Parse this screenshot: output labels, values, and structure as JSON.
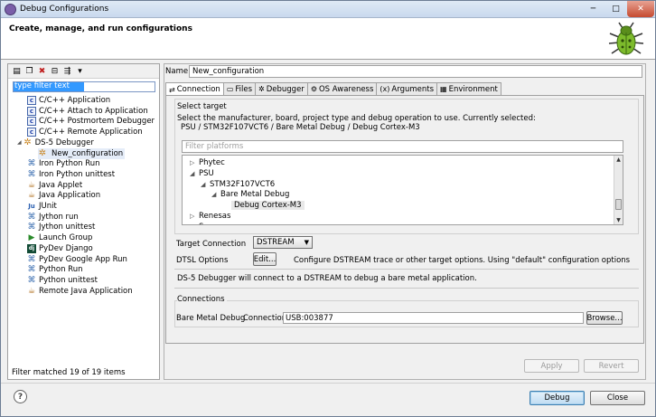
{
  "window": {
    "title": "Debug Configurations",
    "minimize_glyph": "─",
    "maximize_glyph": "□",
    "close_glyph": "✕"
  },
  "header": {
    "heading": "Create, manage, and run configurations",
    "icon": "bug-icon"
  },
  "left": {
    "toolbar": [
      {
        "name": "new-config-icon",
        "glyph": "▤"
      },
      {
        "name": "duplicate-icon",
        "glyph": "❐"
      },
      {
        "name": "delete-icon",
        "glyph": "✖"
      },
      {
        "name": "collapse-all-icon",
        "glyph": "⊟"
      },
      {
        "name": "filter-icon",
        "glyph": "⇶"
      },
      {
        "name": "dropdown-icon",
        "glyph": "▾"
      }
    ],
    "filter_text": "type filter text",
    "tree": [
      {
        "label": "C/C++ Application",
        "icon": "c-icon",
        "depth": 1
      },
      {
        "label": "C/C++ Attach to Application",
        "icon": "c-icon",
        "depth": 1
      },
      {
        "label": "C/C++ Postmortem Debugger",
        "icon": "c-icon",
        "depth": 1
      },
      {
        "label": "C/C++ Remote Application",
        "icon": "c-icon",
        "depth": 1
      },
      {
        "label": "DS-5 Debugger",
        "icon": "ds5-icon",
        "depth": 0,
        "expanded": true
      },
      {
        "label": "New_configuration",
        "icon": "ds5-icon",
        "depth": 2,
        "selected": true
      },
      {
        "label": "Iron Python Run",
        "icon": "python-icon",
        "depth": 1
      },
      {
        "label": "Iron Python unittest",
        "icon": "python-icon",
        "depth": 1
      },
      {
        "label": "Java Applet",
        "icon": "java-icon",
        "depth": 1
      },
      {
        "label": "Java Application",
        "icon": "java-icon",
        "depth": 1
      },
      {
        "label": "JUnit",
        "icon": "junit-icon",
        "depth": 1
      },
      {
        "label": "Jython run",
        "icon": "python-icon",
        "depth": 1
      },
      {
        "label": "Jython unittest",
        "icon": "python-icon",
        "depth": 1
      },
      {
        "label": "Launch Group",
        "icon": "launch-icon",
        "depth": 1
      },
      {
        "label": "PyDev Django",
        "icon": "django-icon",
        "depth": 1
      },
      {
        "label": "PyDev Google App Run",
        "icon": "python-icon",
        "depth": 1
      },
      {
        "label": "Python Run",
        "icon": "python-icon",
        "depth": 1
      },
      {
        "label": "Python unittest",
        "icon": "python-icon",
        "depth": 1
      },
      {
        "label": "Remote Java Application",
        "icon": "java-icon",
        "depth": 1
      }
    ],
    "status": "Filter matched 19 of 19 items"
  },
  "main": {
    "name_label": "Name:",
    "name_value": "New_configuration",
    "tabs": [
      {
        "label": "Connection",
        "icon": "connection-icon",
        "glyph": "⇄",
        "active": true
      },
      {
        "label": "Files",
        "icon": "files-icon",
        "glyph": "▭"
      },
      {
        "label": "Debugger",
        "icon": "debugger-icon",
        "glyph": "✲"
      },
      {
        "label": "OS Awareness",
        "icon": "os-icon",
        "glyph": "⚙"
      },
      {
        "label": "Arguments",
        "icon": "arguments-icon",
        "glyph": "(x)"
      },
      {
        "label": "Environment",
        "icon": "environment-icon",
        "glyph": "▦"
      }
    ],
    "select_target": {
      "title": "Select target",
      "description": "Select the manufacturer, board, project type and debug operation to use. Currently selected:",
      "current": "PSU / STM32F107VCT6 / Bare Metal Debug / Debug Cortex-M3",
      "filter_placeholder": "Filter platforms",
      "tree": [
        {
          "label": "Phytec",
          "arrow": "▷",
          "indent": 0
        },
        {
          "label": "PSU",
          "arrow": "◢",
          "indent": 0
        },
        {
          "label": "STM32F107VCT6",
          "arrow": "◢",
          "indent": 1
        },
        {
          "label": "Bare Metal Debug",
          "arrow": "◢",
          "indent": 2
        },
        {
          "label": "Debug Cortex-M3",
          "arrow": "",
          "indent": 3,
          "selected": true
        },
        {
          "label": "Renesas",
          "arrow": "▷",
          "indent": 0
        },
        {
          "label": "Samsung",
          "arrow": "▷",
          "indent": 0
        }
      ],
      "scroll_up": "▲",
      "scroll_down": "▼"
    },
    "target_connection": {
      "label": "Target Connection",
      "value": "DSTREAM",
      "dropdown": "▼"
    },
    "dtsl": {
      "label": "DTSL Options",
      "button": "Edit...",
      "description": "Configure DSTREAM trace or other target options. Using \"default\" configuration options"
    },
    "summary": "DS-5 Debugger will connect to a DSTREAM to debug a bare metal application.",
    "connections": {
      "title": "Connections",
      "row_label": "Bare Metal Debug",
      "connection_label": "Connection",
      "connection_value": "USB:003877",
      "browse": "Browse..."
    },
    "apply": "Apply",
    "revert": "Revert"
  },
  "footer": {
    "help": "?",
    "debug": "Debug",
    "close": "Close"
  }
}
